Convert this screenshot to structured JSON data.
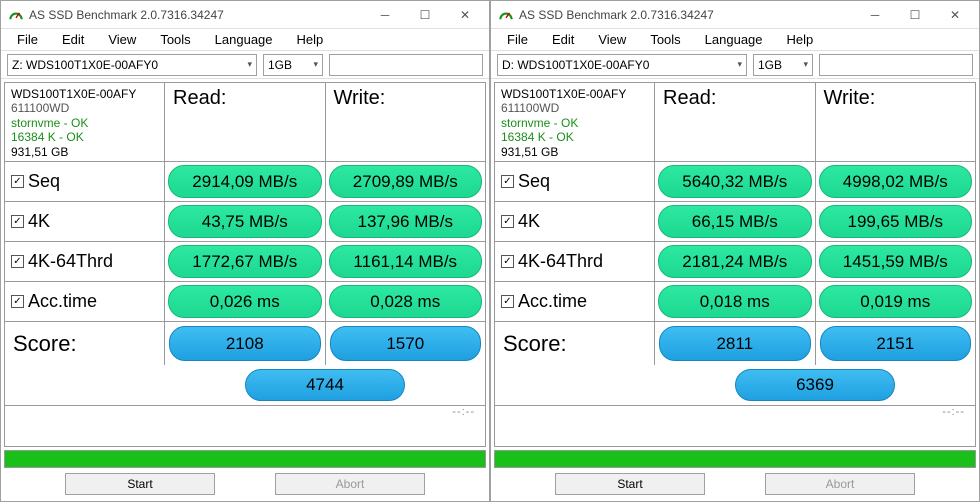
{
  "app_title": "AS SSD Benchmark 2.0.7316.34247",
  "menu": {
    "file": "File",
    "edit": "Edit",
    "view": "View",
    "tools": "Tools",
    "language": "Language",
    "help": "Help"
  },
  "headers": {
    "read": "Read:",
    "write": "Write:",
    "score": "Score:"
  },
  "labels": {
    "seq": "Seq",
    "4k": "4K",
    "4k64": "4K-64Thrd",
    "acc": "Acc.time"
  },
  "buttons": {
    "start": "Start",
    "abort": "Abort"
  },
  "dots": "--:--",
  "windows": [
    {
      "drive_select": "Z: WDS100T1X0E-00AFY0",
      "size_select": "1GB",
      "info": {
        "model": "WDS100T1X0E-00AFY",
        "fw": "611100WD",
        "drv": "stornvme - OK",
        "align": "16384 K - OK",
        "cap": "931,51 GB"
      },
      "seq_r": "2914,09 MB/s",
      "seq_w": "2709,89 MB/s",
      "k4_r": "43,75 MB/s",
      "k4_w": "137,96 MB/s",
      "k64_r": "1772,67 MB/s",
      "k64_w": "1161,14 MB/s",
      "acc_r": "0,026 ms",
      "acc_w": "0,028 ms",
      "score_r": "2108",
      "score_w": "1570",
      "score_t": "4744"
    },
    {
      "drive_select": "D: WDS100T1X0E-00AFY0",
      "size_select": "1GB",
      "info": {
        "model": "WDS100T1X0E-00AFY",
        "fw": "611100WD",
        "drv": "stornvme - OK",
        "align": "16384 K - OK",
        "cap": "931,51 GB"
      },
      "seq_r": "5640,32 MB/s",
      "seq_w": "4998,02 MB/s",
      "k4_r": "66,15 MB/s",
      "k4_w": "199,65 MB/s",
      "k64_r": "2181,24 MB/s",
      "k64_w": "1451,59 MB/s",
      "acc_r": "0,018 ms",
      "acc_w": "0,019 ms",
      "score_r": "2811",
      "score_w": "2151",
      "score_t": "6369"
    }
  ]
}
